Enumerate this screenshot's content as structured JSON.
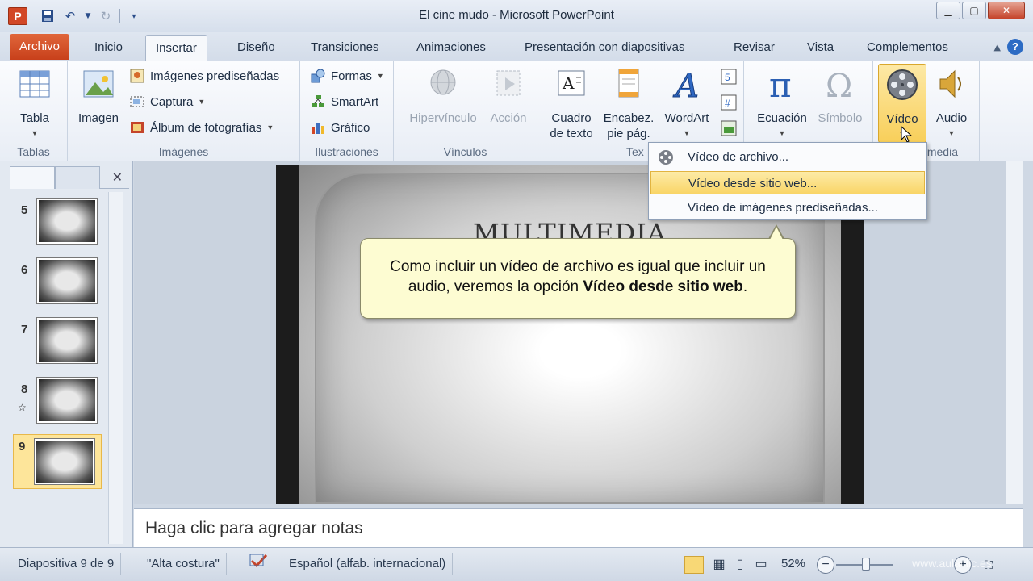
{
  "window": {
    "title": "El cine mudo  -  Microsoft PowerPoint",
    "app_letter": "P"
  },
  "tabs": [
    {
      "label": "Archivo"
    },
    {
      "label": "Inicio"
    },
    {
      "label": "Insertar"
    },
    {
      "label": "Diseño"
    },
    {
      "label": "Transiciones"
    },
    {
      "label": "Animaciones"
    },
    {
      "label": "Presentación con diapositivas"
    },
    {
      "label": "Revisar"
    },
    {
      "label": "Vista"
    },
    {
      "label": "Complementos"
    }
  ],
  "ribbon": {
    "tablas": {
      "button": "Tabla",
      "group": "Tablas"
    },
    "imagenes": {
      "imagen": "Imagen",
      "predisenadas": "Imágenes prediseñadas",
      "captura": "Captura",
      "album": "Álbum de fotografías",
      "group": "Imágenes"
    },
    "ilustraciones": {
      "formas": "Formas",
      "smartart": "SmartArt",
      "grafico": "Gráfico",
      "group": "Ilustraciones"
    },
    "vinculos": {
      "hipervinculo": "Hipervínculo",
      "accion": "Acción",
      "group": "Vínculos"
    },
    "texto": {
      "cuadro_l1": "Cuadro",
      "cuadro_l2": "de texto",
      "encabez_l1": "Encabez.",
      "encabez_l2": "pie pág.",
      "wordart": "WordArt",
      "group": "Tex"
    },
    "simbolos": {
      "ecuacion": "Ecuación",
      "simbolo": "Símbolo"
    },
    "multimedia": {
      "video": "Vídeo",
      "audio": "Audio",
      "group": "media"
    }
  },
  "video_menu": {
    "items": [
      {
        "label": "Vídeo de archivo..."
      },
      {
        "label": "Vídeo desde sitio web..."
      },
      {
        "label": "Vídeo de imágenes prediseñadas..."
      }
    ]
  },
  "slides": [
    {
      "number": "5"
    },
    {
      "number": "6"
    },
    {
      "number": "7"
    },
    {
      "number": "8"
    },
    {
      "number": "9"
    }
  ],
  "slide": {
    "title": "MULTIMEDIA"
  },
  "callout": {
    "text_before": "Como incluir un vídeo de archivo es igual que incluir un audio, veremos la opción ",
    "text_bold": "Vídeo desde sitio web",
    "text_after": "."
  },
  "notes": {
    "placeholder": "Haga clic para agregar notas"
  },
  "statusbar": {
    "slide_info": "Diapositiva 9 de 9",
    "theme": "\"Alta costura\"",
    "language": "Español (alfab. internacional)",
    "zoom": "52%"
  },
  "watermark": "www.aulaclic.es"
}
